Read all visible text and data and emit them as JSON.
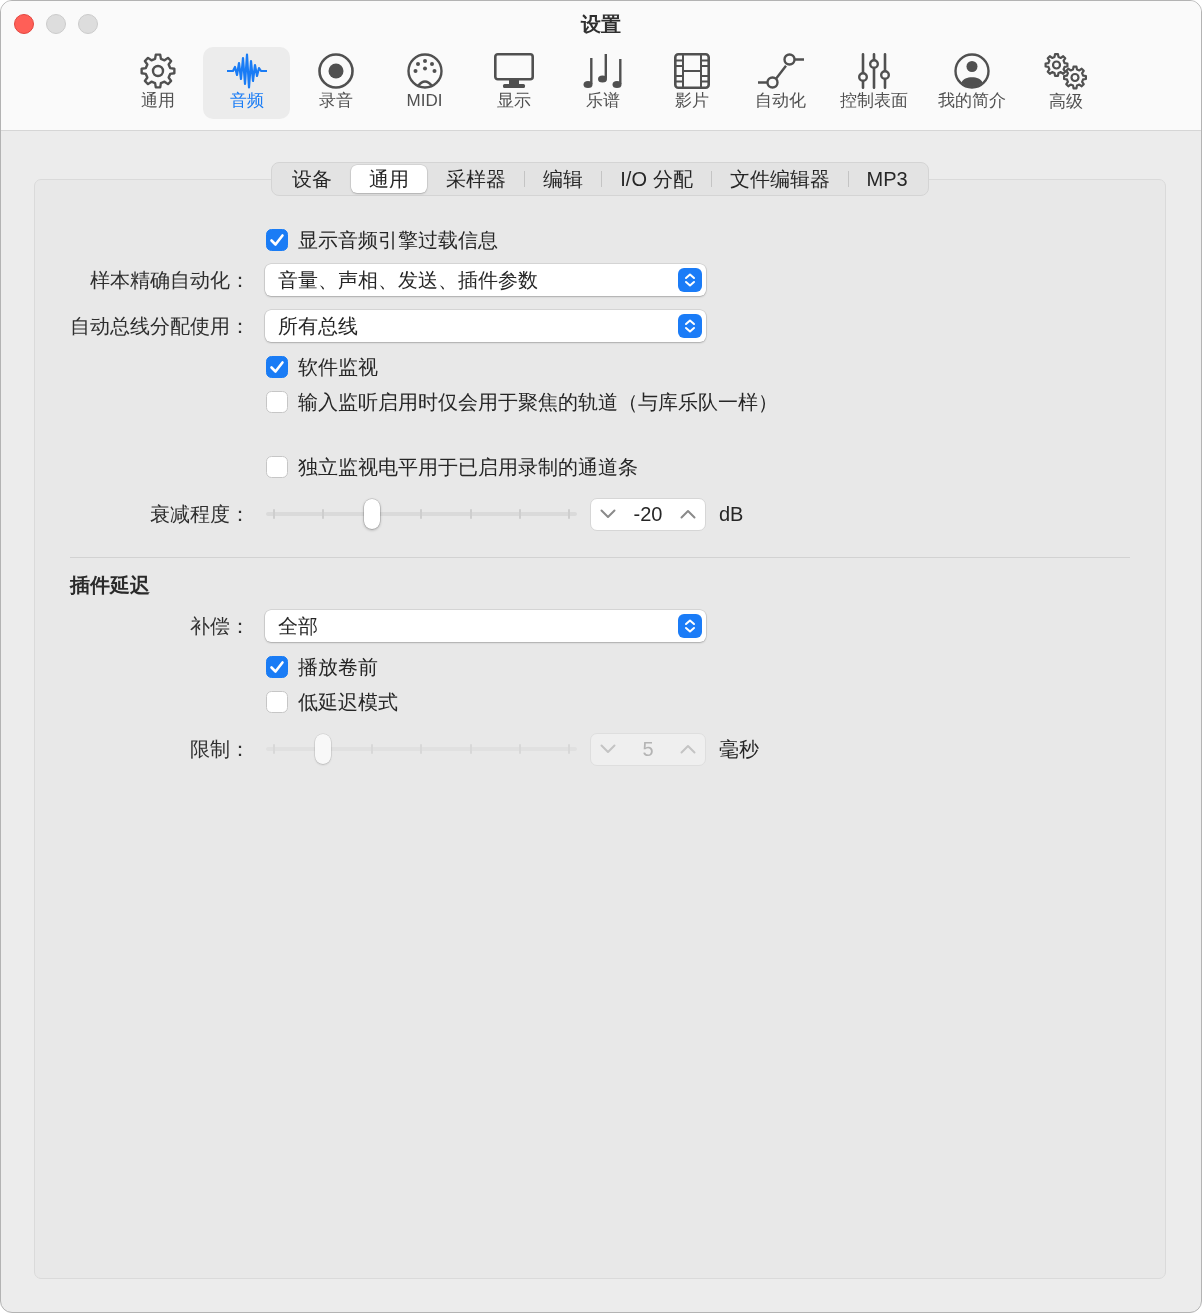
{
  "window": {
    "title": "设置"
  },
  "toolbar": [
    {
      "label": "通用",
      "selected": false
    },
    {
      "label": "音频",
      "selected": true
    },
    {
      "label": "录音",
      "selected": false
    },
    {
      "label": "MIDI",
      "selected": false
    },
    {
      "label": "显示",
      "selected": false
    },
    {
      "label": "乐谱",
      "selected": false
    },
    {
      "label": "影片",
      "selected": false
    },
    {
      "label": "自动化",
      "selected": false
    },
    {
      "label": "控制表面",
      "selected": false
    },
    {
      "label": "我的简介",
      "selected": false
    },
    {
      "label": "高级",
      "selected": false
    }
  ],
  "tabs": [
    {
      "label": "设备",
      "selected": false
    },
    {
      "label": "通用",
      "selected": true
    },
    {
      "label": "采样器",
      "selected": false
    },
    {
      "label": "编辑",
      "selected": false
    },
    {
      "label": "I/O 分配",
      "selected": false
    },
    {
      "label": "文件编辑器",
      "selected": false
    },
    {
      "label": "MP3",
      "selected": false
    }
  ],
  "sections": [
    {
      "rows": [
        {
          "kind": "checkbox",
          "label": "显示音频引擎过载信息",
          "checked": true
        },
        {
          "kind": "popup",
          "label": "样本精确自动化：",
          "value": "音量、声相、发送、插件参数"
        },
        {
          "kind": "popup",
          "label": "自动总线分配使用：",
          "value": "所有总线"
        },
        {
          "kind": "checkbox",
          "label": "软件监视",
          "checked": true
        },
        {
          "kind": "checkbox",
          "label": "输入监听启用时仅会用于聚焦的轨道（与库乐队一样）",
          "checked": false
        }
      ]
    },
    {
      "rows": [
        {
          "kind": "checkbox",
          "label": "独立监视电平用于已启用录制的通道条",
          "checked": false
        },
        {
          "kind": "slider",
          "label": "衰减程度：",
          "level": 0.333,
          "value": "-20",
          "unit": "dB",
          "disabled": false
        }
      ]
    },
    {
      "heading": "插件延迟",
      "rows": [
        {
          "kind": "popup",
          "label": "补偿：",
          "value": "全部"
        },
        {
          "kind": "checkbox",
          "label": "播放卷前",
          "checked": true
        },
        {
          "kind": "checkbox",
          "label": "低延迟模式",
          "checked": false
        },
        {
          "kind": "slider",
          "label": "限制：",
          "level": 0.167,
          "value": "5",
          "unit": "毫秒",
          "disabled": true
        }
      ]
    }
  ]
}
